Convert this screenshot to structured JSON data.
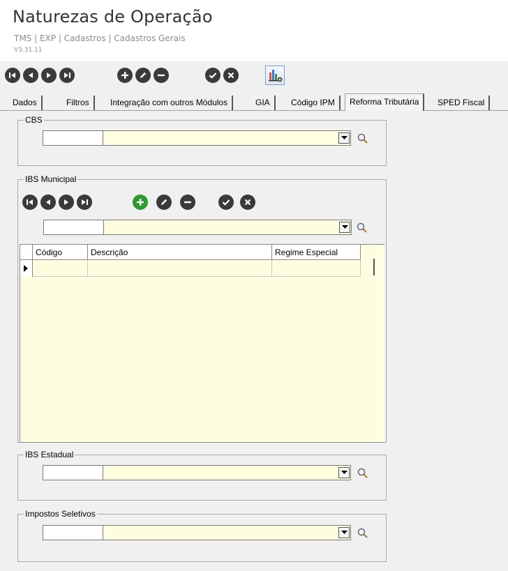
{
  "header": {
    "title": "Naturezas de Operação",
    "breadcrumb": "TMS | EXP | Cadastros | Cadastros Gerais",
    "version": "V3.31.11"
  },
  "toolbar": {
    "buttons": [
      "first",
      "previous",
      "next",
      "last",
      "add",
      "edit",
      "remove",
      "confirm",
      "cancel",
      "report"
    ]
  },
  "tabs": [
    {
      "label": "Dados",
      "active": false
    },
    {
      "label": "Filtros",
      "active": false
    },
    {
      "label": "Integração com outros Módulos",
      "active": false
    },
    {
      "label": "GIA",
      "active": false
    },
    {
      "label": "Código IPM",
      "active": false
    },
    {
      "label": "Reforma Tributária",
      "active": true
    },
    {
      "label": "SPED Fiscal",
      "active": false
    }
  ],
  "groups": {
    "cbs": {
      "label": "CBS",
      "code": "",
      "description": ""
    },
    "ibs_municipal": {
      "label": "IBS Municipal",
      "code": "",
      "description": "",
      "grid": {
        "columns": [
          "Código",
          "Descrição",
          "Regime Especial"
        ],
        "rows": [
          [
            "",
            "",
            ""
          ]
        ]
      }
    },
    "ibs_estadual": {
      "label": "IBS Estadual",
      "code": "",
      "description": ""
    },
    "impostos_seletivos": {
      "label": "Impostos Seletivos",
      "code": "",
      "description": ""
    }
  },
  "colors": {
    "field_bg": "#fffde0",
    "button_dark": "#3a3a3a",
    "button_add": "#2e9a2e"
  }
}
